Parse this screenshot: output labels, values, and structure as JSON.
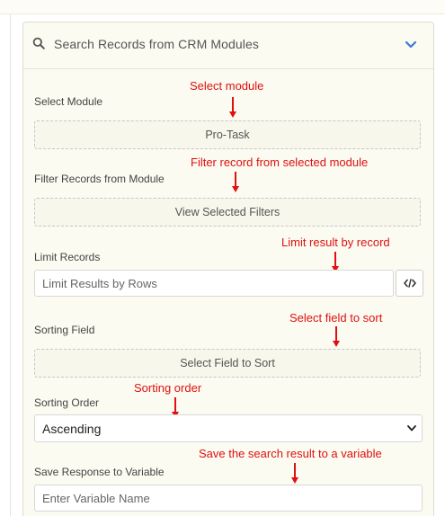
{
  "panel": {
    "title": "Search Records from CRM Modules"
  },
  "fields": {
    "module_label": "Select Module",
    "module_button": "Pro-Task",
    "filter_label": "Filter Records from Module",
    "filter_button": "View Selected Filters",
    "limit_label": "Limit Records",
    "limit_placeholder": "Limit Results by Rows",
    "sorting_field_label": "Sorting Field",
    "sorting_field_button": "Select Field to Sort",
    "sorting_order_label": "Sorting Order",
    "sorting_order_value": "Ascending",
    "save_label": "Save Response to Variable",
    "save_placeholder": "Enter Variable Name"
  },
  "annotations": {
    "module": "Select module",
    "filter": "Filter record from selected module",
    "limit": "Limit result by record",
    "sort_field": "Select field to sort",
    "sort_order": "Sorting order",
    "save": "Save the search result to a variable"
  },
  "colors": {
    "annotation": "#e01010",
    "accent": "#3a7bd5",
    "panel_bg": "#fbfbf1"
  },
  "icons": {
    "header_left": "search-icon",
    "header_right": "chevron-down-icon",
    "limit_button": "code-icon",
    "select": "chevron-down-icon"
  }
}
